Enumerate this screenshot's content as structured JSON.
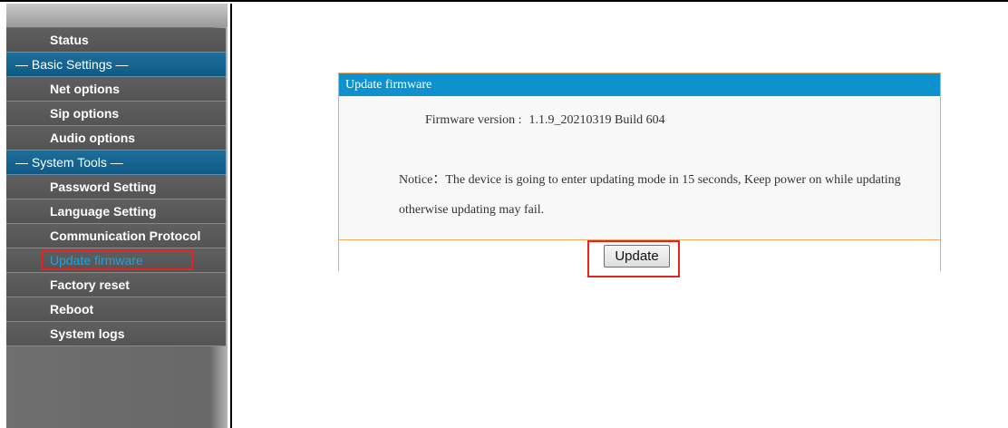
{
  "sidebar": {
    "items": [
      {
        "label": "Status",
        "type": "item"
      },
      {
        "label": "— Basic Settings —",
        "type": "section"
      },
      {
        "label": "Net options",
        "type": "item"
      },
      {
        "label": "Sip options",
        "type": "item"
      },
      {
        "label": "Audio options",
        "type": "item"
      },
      {
        "label": "— System Tools —",
        "type": "section"
      },
      {
        "label": "Password Setting",
        "type": "item"
      },
      {
        "label": "Language Setting",
        "type": "item"
      },
      {
        "label": "Communication Protocol",
        "type": "item"
      },
      {
        "label": "Update firmware",
        "type": "item",
        "active": true
      },
      {
        "label": "Factory reset",
        "type": "item"
      },
      {
        "label": "Reboot",
        "type": "item"
      },
      {
        "label": "System logs",
        "type": "item"
      }
    ]
  },
  "panel": {
    "title": "Update firmware",
    "firmware_label": "Firmware version :",
    "firmware_value": "1.1.9_20210319 Build 604",
    "notice": "Notice：The device is going to enter updating mode in 15 seconds, Keep power on while updating otherwise updating may fail.",
    "update_button": "Update"
  },
  "colors": {
    "header_blue": "#0e92ce",
    "panel_border": "#f2a75a",
    "highlight_red": "#e52121",
    "active_link": "#16a6e6"
  }
}
